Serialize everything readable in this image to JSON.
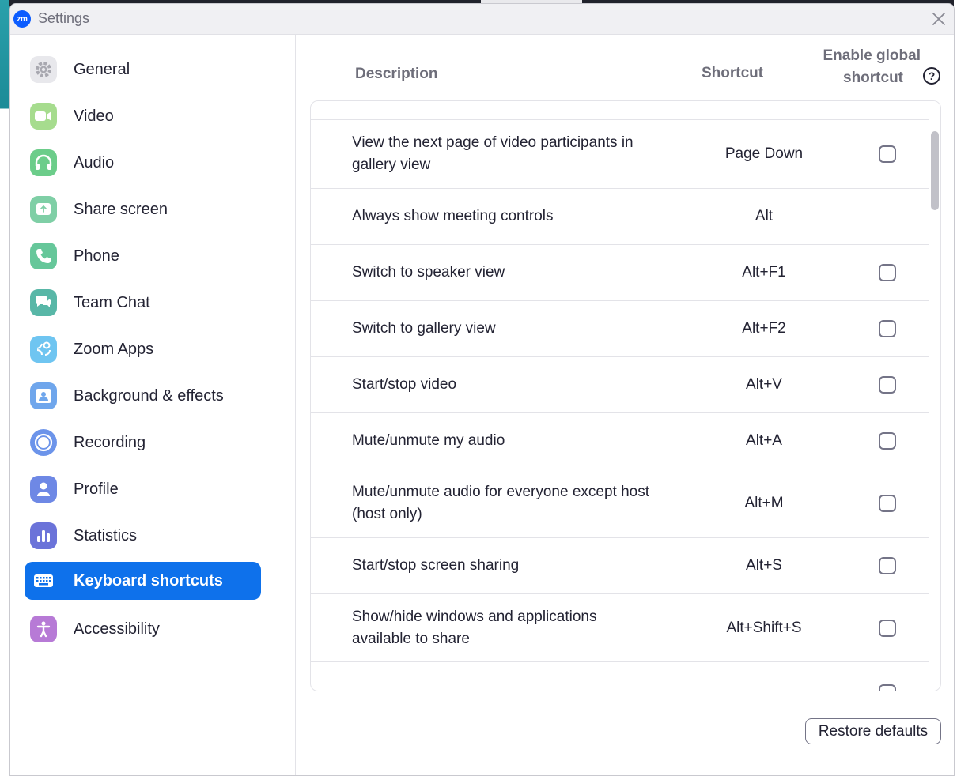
{
  "window": {
    "title": "Settings",
    "logo_text": "zm"
  },
  "sidebar": {
    "items": [
      {
        "label": "General",
        "icon": "gear-icon",
        "color": "#e8e8ec"
      },
      {
        "label": "Video",
        "icon": "video-camera-icon",
        "color": "#a6dc8e"
      },
      {
        "label": "Audio",
        "icon": "headphones-icon",
        "color": "#6ccd8a"
      },
      {
        "label": "Share screen",
        "icon": "share-screen-icon",
        "color": "#7fcfa6"
      },
      {
        "label": "Phone",
        "icon": "phone-icon",
        "color": "#66c79a"
      },
      {
        "label": "Team Chat",
        "icon": "chat-icon",
        "color": "#58b7a7"
      },
      {
        "label": "Zoom Apps",
        "icon": "apps-icon",
        "color": "#6fc5f1"
      },
      {
        "label": "Background & effects",
        "icon": "background-icon",
        "color": "#6fa6ec"
      },
      {
        "label": "Recording",
        "icon": "record-icon",
        "color": "#6c94ea"
      },
      {
        "label": "Profile",
        "icon": "profile-icon",
        "color": "#6e88e5"
      },
      {
        "label": "Statistics",
        "icon": "statistics-icon",
        "color": "#6b73d9"
      },
      {
        "label": "Keyboard shortcuts",
        "icon": "keyboard-icon",
        "color": "#0e71eb",
        "active": true
      },
      {
        "label": "Accessibility",
        "icon": "accessibility-icon",
        "color": "#b77ad6"
      }
    ]
  },
  "table": {
    "headers": {
      "description": "Description",
      "shortcut": "Shortcut",
      "global_line1": "Enable global",
      "global_line2": "shortcut"
    },
    "rows": [
      {
        "description": "View the next page of video participants in gallery view",
        "shortcut": "Page Down",
        "has_checkbox": true,
        "checked": false
      },
      {
        "description": "Always show meeting controls",
        "shortcut": "Alt",
        "has_checkbox": false
      },
      {
        "description": "Switch to speaker view",
        "shortcut": "Alt+F1",
        "has_checkbox": true,
        "checked": false
      },
      {
        "description": "Switch to gallery view",
        "shortcut": "Alt+F2",
        "has_checkbox": true,
        "checked": false
      },
      {
        "description": "Start/stop video",
        "shortcut": "Alt+V",
        "has_checkbox": true,
        "checked": false
      },
      {
        "description": "Mute/unmute my audio",
        "shortcut": "Alt+A",
        "has_checkbox": true,
        "checked": false
      },
      {
        "description": "Mute/unmute audio for everyone except host (host only)",
        "shortcut": "Alt+M",
        "has_checkbox": true,
        "checked": false
      },
      {
        "description": "Start/stop screen sharing",
        "shortcut": "Alt+S",
        "has_checkbox": true,
        "checked": false
      },
      {
        "description": "Show/hide windows and applications available to share",
        "shortcut": "Alt+Shift+S",
        "has_checkbox": true,
        "checked": false
      }
    ]
  },
  "buttons": {
    "restore_defaults": "Restore defaults"
  },
  "colors": {
    "accent": "#0e71eb",
    "text": "#232333",
    "muted": "#6e6e7a",
    "border": "#e3e3e8"
  }
}
